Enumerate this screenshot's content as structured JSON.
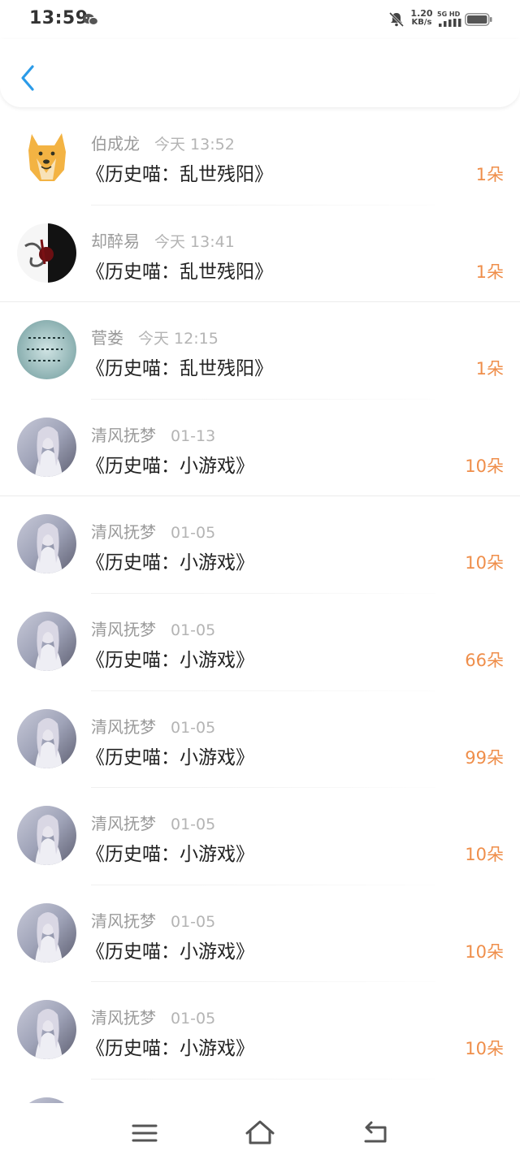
{
  "status_bar": {
    "time": "13:59",
    "net_speed_value": "1.20",
    "net_speed_unit": "KB/s",
    "network": "5G HD",
    "icons": [
      "wechat-icon",
      "mute-bell-icon",
      "signal-icon",
      "battery-icon"
    ]
  },
  "header": {
    "back_icon": "chevron-left-icon",
    "accent_color": "#2b9be8"
  },
  "gifts": [
    {
      "name": "伯成龙",
      "date": "今天 13:52",
      "title": "《历史喵：乱世残阳》",
      "amount": "1朵",
      "avatar": "doge-avatar"
    },
    {
      "name": "却醉易",
      "date": "今天 13:41",
      "title": "《历史喵：乱世残阳》",
      "amount": "1朵",
      "avatar": "ink-avatar"
    },
    {
      "name": "菅娄",
      "date": "今天 12:15",
      "title": "《历史喵：乱世残阳》",
      "amount": "1朵",
      "avatar": "calligraphy-avatar"
    },
    {
      "name": "清风抚梦",
      "date": "01-13",
      "title": "《历史喵：小游戏》",
      "amount": "10朵",
      "avatar": "anime-girl-avatar"
    },
    {
      "name": "清风抚梦",
      "date": "01-05",
      "title": "《历史喵：小游戏》",
      "amount": "10朵",
      "avatar": "anime-girl-avatar"
    },
    {
      "name": "清风抚梦",
      "date": "01-05",
      "title": "《历史喵：小游戏》",
      "amount": "66朵",
      "avatar": "anime-girl-avatar"
    },
    {
      "name": "清风抚梦",
      "date": "01-05",
      "title": "《历史喵：小游戏》",
      "amount": "99朵",
      "avatar": "anime-girl-avatar"
    },
    {
      "name": "清风抚梦",
      "date": "01-05",
      "title": "《历史喵：小游戏》",
      "amount": "10朵",
      "avatar": "anime-girl-avatar"
    },
    {
      "name": "清风抚梦",
      "date": "01-05",
      "title": "《历史喵：小游戏》",
      "amount": "10朵",
      "avatar": "anime-girl-avatar"
    },
    {
      "name": "清风抚梦",
      "date": "01-05",
      "title": "《历史喵：小游戏》",
      "amount": "10朵",
      "avatar": "anime-girl-avatar"
    }
  ],
  "colors": {
    "amount": "#ef8e4a",
    "name": "#9a9a9a",
    "date": "#b4b4b4",
    "title": "#222222"
  },
  "nav_bar": {
    "icons": [
      "menu-icon",
      "home-icon",
      "back-icon"
    ]
  }
}
